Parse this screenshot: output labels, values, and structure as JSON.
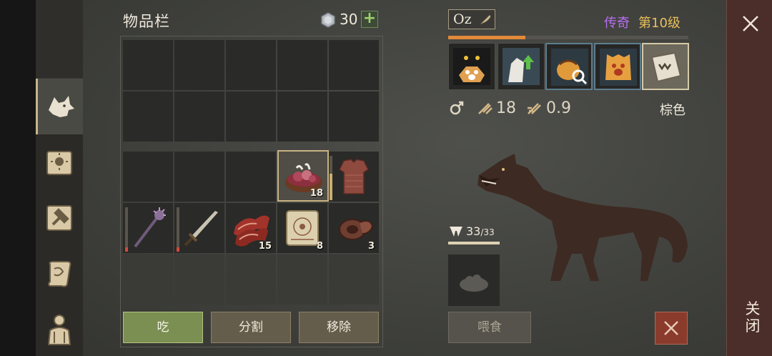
{
  "inventory": {
    "title": "物品栏",
    "currency_icon": "gem-icon",
    "currency_count": "30",
    "add_label": "+",
    "items": [
      {
        "name": "raw-meat-bowl",
        "qty": "18"
      },
      {
        "name": "chainmail-armor",
        "qty": ""
      },
      {
        "name": "spiked-mace",
        "qty": "",
        "durability": 0.1
      },
      {
        "name": "sword",
        "qty": "",
        "durability": 0.1
      },
      {
        "name": "bacon-strips",
        "qty": "15"
      },
      {
        "name": "recipe-scroll",
        "qty": "8"
      },
      {
        "name": "leather-roll",
        "qty": "3"
      }
    ],
    "buttons": {
      "eat": "吃",
      "split": "分割",
      "remove": "移除"
    }
  },
  "pet": {
    "name": "Oz",
    "rarity": "传奇",
    "level": "第10级",
    "xp_progress": 0.32,
    "gender_icon": "male-icon",
    "attack_value": "18",
    "attack_speed_value": "0.9",
    "fur_color": "棕色",
    "hunger_current": "33",
    "hunger_max": "/33",
    "hunger_progress": 1.0,
    "feed_label": "喂食",
    "skills": [
      "shadow-paw-icon",
      "wolf-upgrade-icon",
      "bag-search-icon",
      "paw-shield-icon",
      "fang-book-icon"
    ]
  },
  "colors": {
    "accent_orange": "#e08a3a",
    "rarity_purple": "#b86ef0",
    "level_gold": "#e8c05c",
    "eat_green": "#7b8f52"
  },
  "close_label": "关闭"
}
